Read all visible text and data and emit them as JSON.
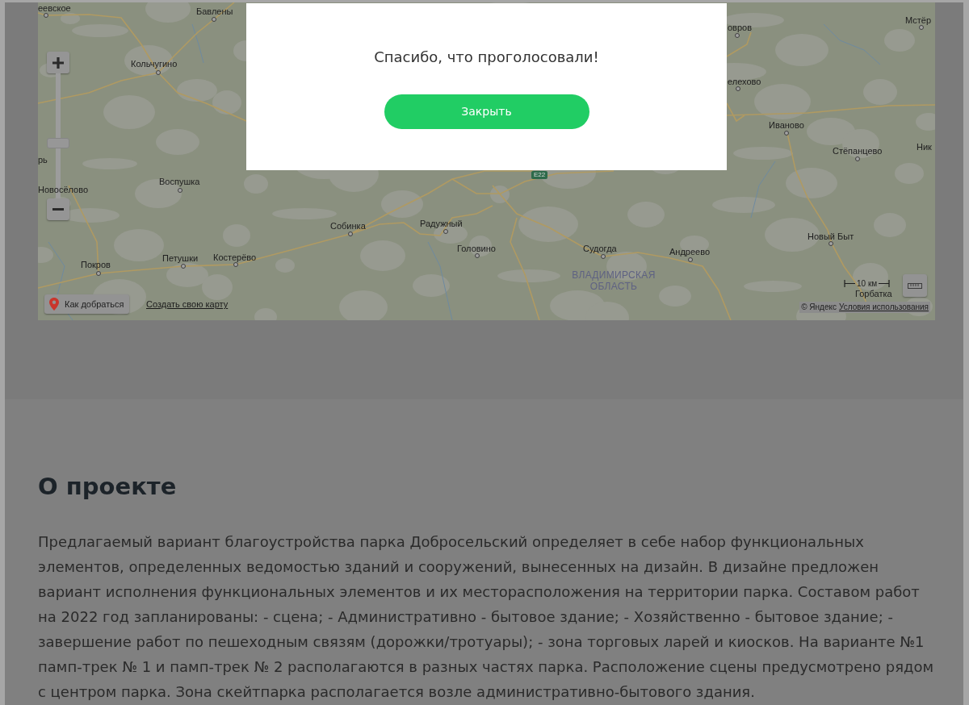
{
  "map": {
    "labels": [
      {
        "kind": "town",
        "text": "еевское"
      },
      {
        "kind": "town",
        "text": "Бавлены"
      },
      {
        "kind": "town",
        "text": "Кольчугино"
      },
      {
        "kind": "town",
        "text": "рь"
      },
      {
        "kind": "town",
        "text": "Новосёлово"
      },
      {
        "kind": "town",
        "text": "Воспушка"
      },
      {
        "kind": "town",
        "text": "Покров"
      },
      {
        "kind": "town",
        "text": "Петушки"
      },
      {
        "kind": "town",
        "text": "Костерёво"
      },
      {
        "kind": "town",
        "text": "Собинка"
      },
      {
        "kind": "town",
        "text": "Радужный"
      },
      {
        "kind": "town",
        "text": "Головино"
      },
      {
        "kind": "town",
        "text": "Судогда"
      },
      {
        "kind": "town",
        "text": "Андреево"
      },
      {
        "kind": "region",
        "text": "ВЛАДИМИРСКАЯ ОБЛАСТЬ"
      },
      {
        "kind": "town",
        "text": "овров"
      },
      {
        "kind": "town",
        "text": "Мстёр"
      },
      {
        "kind": "town",
        "text": "елехово"
      },
      {
        "kind": "town",
        "text": "Иваново"
      },
      {
        "kind": "town",
        "text": "Стёпанцево"
      },
      {
        "kind": "town",
        "text": "Ник"
      },
      {
        "kind": "town",
        "text": "Новый Быт"
      },
      {
        "kind": "town",
        "text": "Горбатка"
      },
      {
        "kind": "road",
        "text": "E22"
      }
    ],
    "zoom_slider": {
      "level": 0.44
    },
    "route_button": "Как добраться",
    "create_map_link": "Создать свою карту",
    "scale": "10 км",
    "copyright": "© Яндекс",
    "terms_link": "Условия использования"
  },
  "dialog": {
    "message": "Спасибо, что проголосовали!",
    "close_button": "Закрыть"
  },
  "about": {
    "heading": "О проекте",
    "paragraph": "Предлагаемый вариант благоустройства парка Добросельский определяет в себе набор функциональных элементов, определенных ведомостью зданий и сооружений, вынесенных на дизайн. В дизайне предложен вариант исполнения функциональных элементов и их месторасположения на территории парка. Составом работ на 2022 год запланированы: - сцена; - Административно - бытовое здание; - Хозяйственно - бытовое здание; - завершение работ по пешеходным связям (дорожки/тротуары); - зона торговых ларей и киосков. На варианте №1 памп-трек № 1 и памп-трек № 2 располагаются в разных частях парка. Расположение сцены предусмотрено рядом с центром парка. Зона скейтпарка располагается возле административно-бытового здания."
  }
}
